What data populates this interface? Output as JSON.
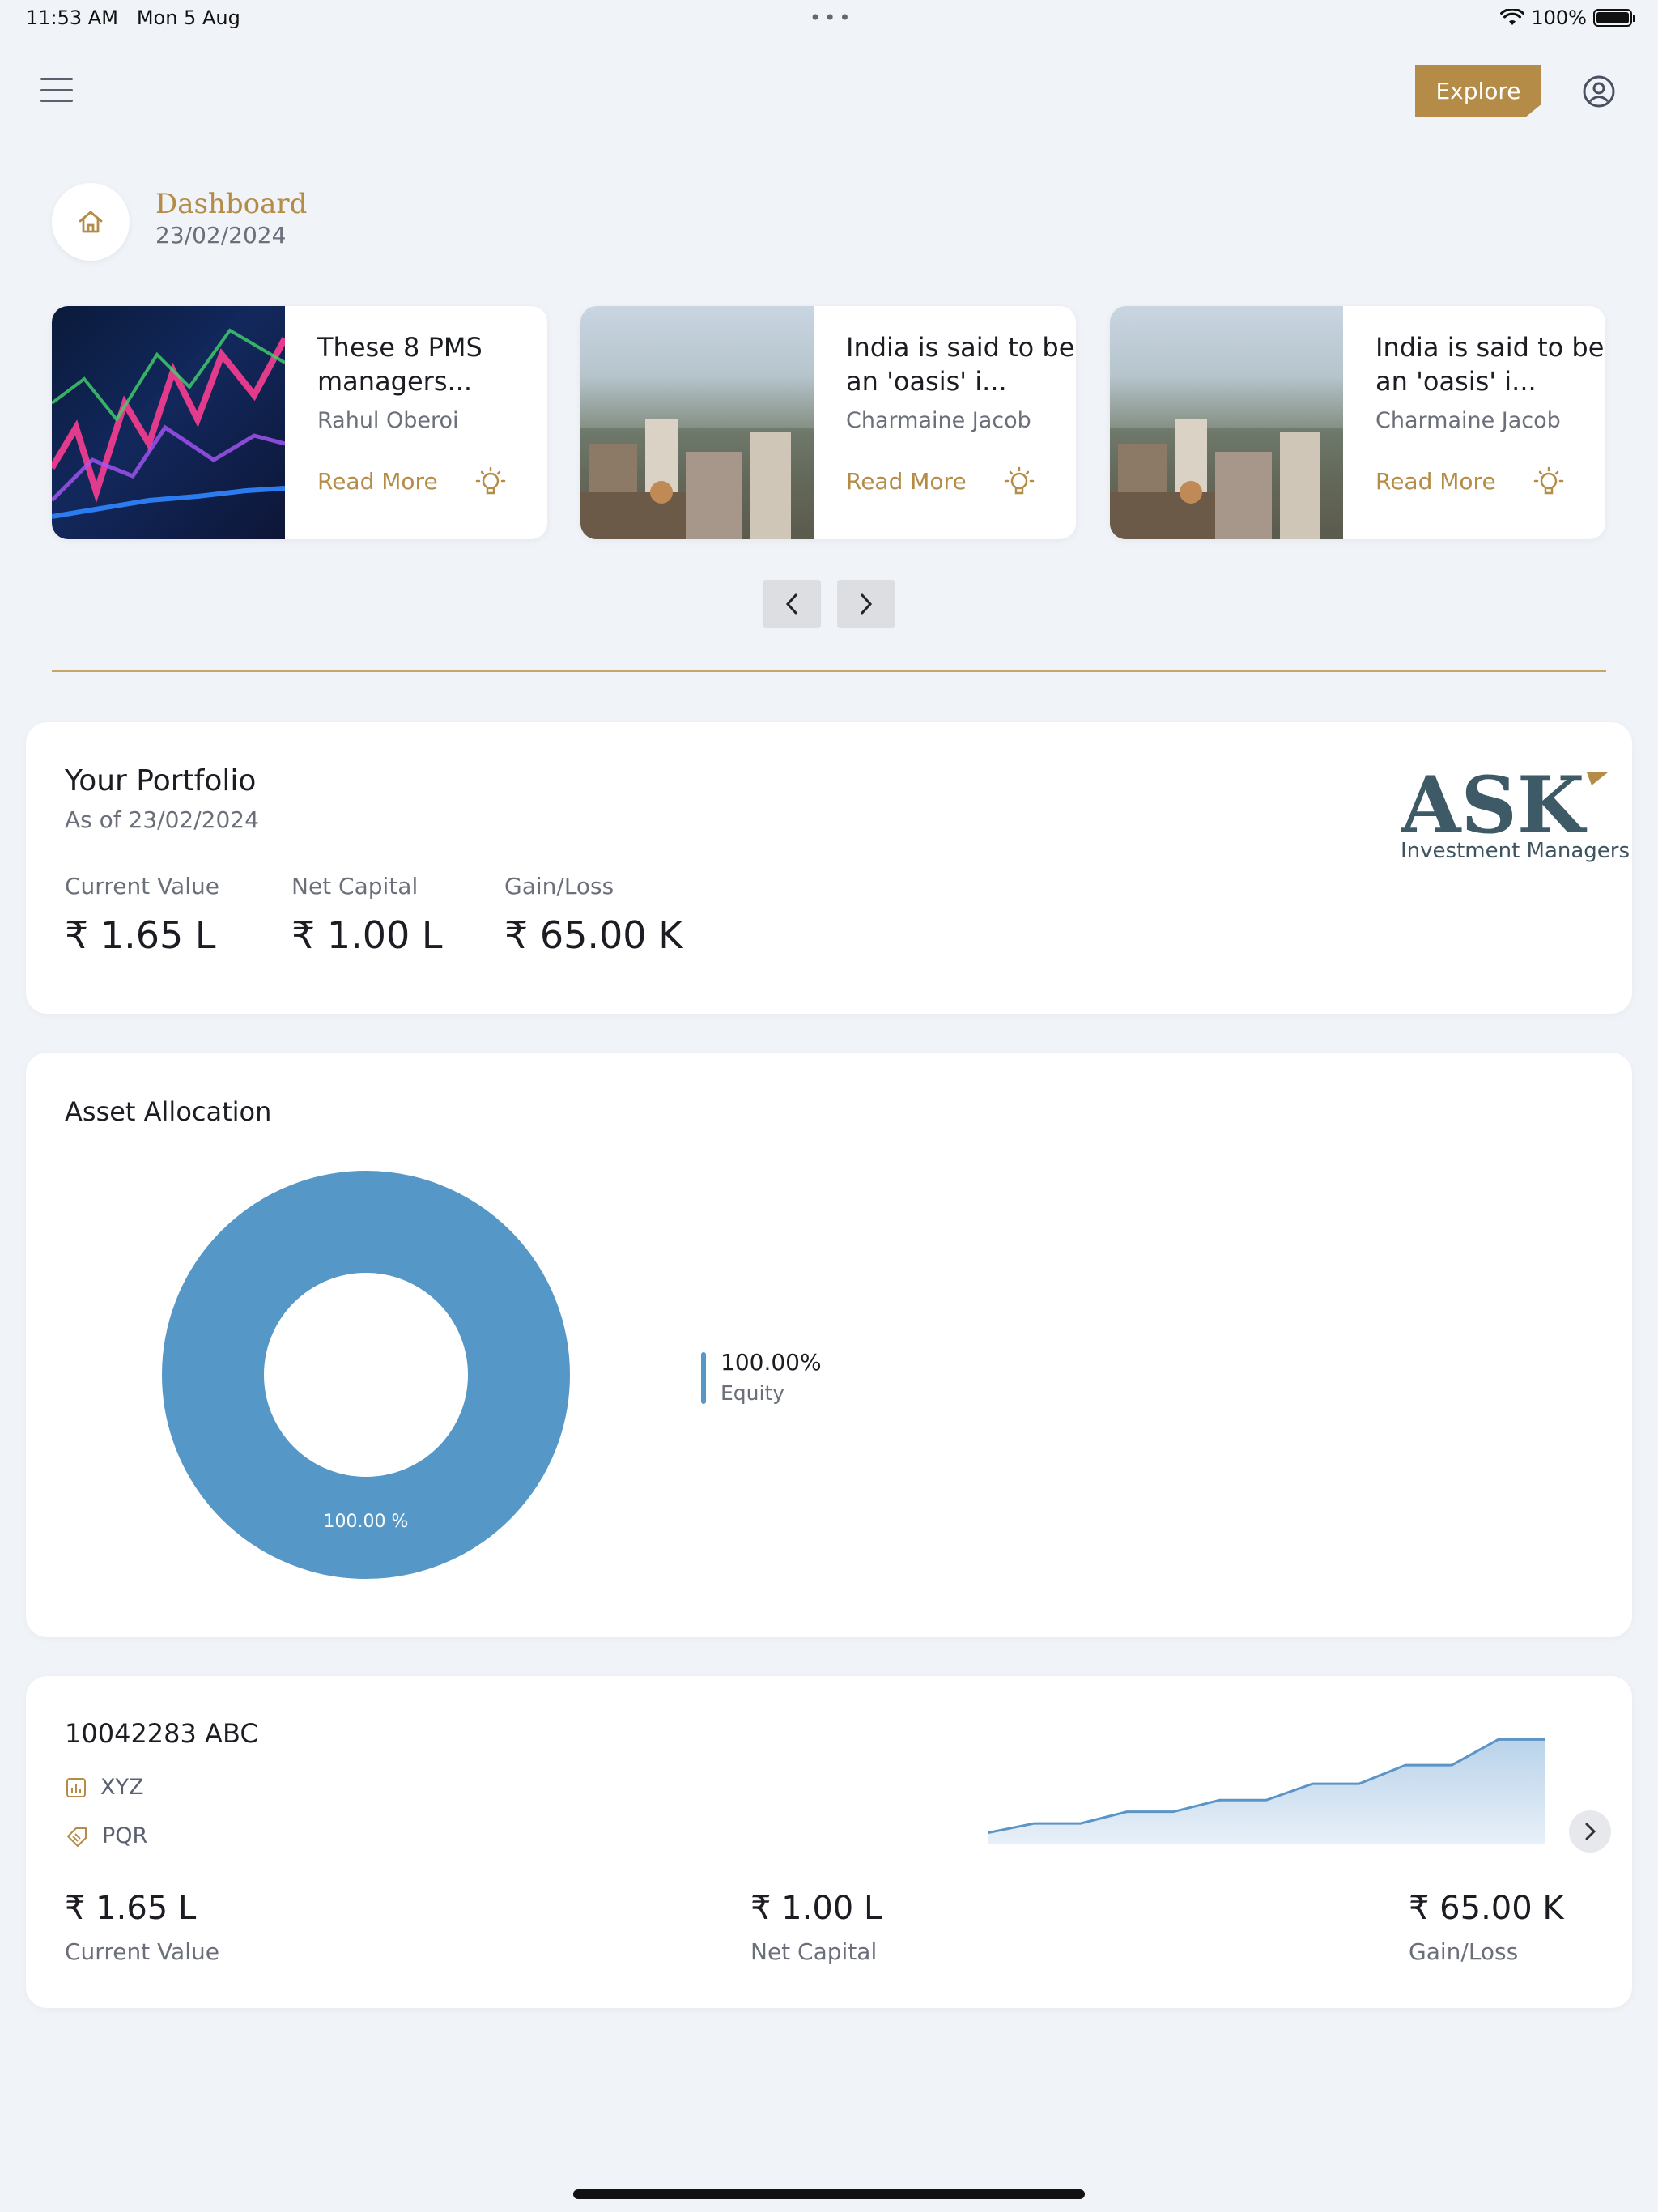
{
  "status_bar": {
    "time": "11:53 AM",
    "date": "Mon 5 Aug",
    "dots": "•••",
    "battery": "100%"
  },
  "header": {
    "explore_label": "Explore",
    "menu_icon": "hamburger-menu-icon",
    "profile_icon": "user-circle-icon"
  },
  "dashboard": {
    "title": "Dashboard",
    "date": "23/02/2024",
    "icon": "home-icon"
  },
  "news": [
    {
      "title": "These 8 PMS managers...",
      "author": "Rahul Oberoi",
      "read_more": "Read More",
      "image": "stock-chart-image"
    },
    {
      "title": "India is said to be an 'oasis' i...",
      "author": "Charmaine Jacob",
      "read_more": "Read More",
      "image": "city-skyline-image"
    },
    {
      "title": "India is said to be an 'oasis' i...",
      "author": "Charmaine Jacob",
      "read_more": "Read More",
      "image": "city-skyline-image"
    }
  ],
  "portfolio": {
    "title": "Your Portfolio",
    "as_of": "As of 23/02/2024",
    "metrics": [
      {
        "label": "Current Value",
        "value": "₹ 1.65 L"
      },
      {
        "label": "Net Capital",
        "value": "₹ 1.00 L"
      },
      {
        "label": "Gain/Loss",
        "value": "₹ 65.00 K"
      }
    ],
    "brand": {
      "name": "ASK",
      "subtitle": "Investment Managers",
      "color": "#3d5a66",
      "accent": "#b48c47"
    }
  },
  "allocation": {
    "title": "Asset Allocation",
    "slice_label": "100.00 %",
    "legend": [
      {
        "value": "100.00%",
        "name": "Equity",
        "color": "#5597c7"
      }
    ]
  },
  "chart_data": {
    "type": "pie",
    "categories": [
      "Equity"
    ],
    "values": [
      100.0
    ],
    "title": "Asset Allocation",
    "donut": true,
    "colors": [
      "#5597c7"
    ]
  },
  "account": {
    "title": "10042283 ABC",
    "rows": [
      {
        "icon": "bar-chart-icon",
        "label": "XYZ"
      },
      {
        "icon": "tag-icon",
        "label": "PQR"
      }
    ],
    "values": [
      {
        "value": "₹ 1.65 L",
        "label": "Current Value"
      },
      {
        "value": "₹ 1.00 L",
        "label": "Net Capital"
      },
      {
        "value": "₹ 65.00 K",
        "label": "Gain/Loss"
      }
    ],
    "sparkline_steps": [
      0.1,
      0.18,
      0.18,
      0.28,
      0.28,
      0.38,
      0.38,
      0.52,
      0.52,
      0.68,
      0.68,
      0.9,
      0.9
    ]
  },
  "colors": {
    "accent_gold": "#b48c47",
    "chart_blue": "#5597c7",
    "background": "#f0f3f8"
  }
}
